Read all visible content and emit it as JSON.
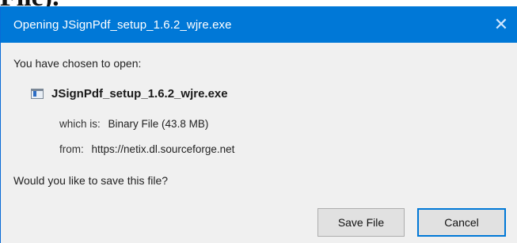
{
  "background_fragment": "File).",
  "dialog": {
    "title": "Opening JSignPdf_setup_1.6.2_wjre.exe",
    "close_glyph": "✕",
    "prompt": "You have chosen to open:",
    "file": {
      "icon": "executable-file-icon",
      "name": "JSignPdf_setup_1.6.2_wjre.exe"
    },
    "which_is": {
      "key": "which is:",
      "value": "Binary File (43.8 MB)"
    },
    "from": {
      "key": "from:",
      "value": "https://netix.dl.sourceforge.net"
    },
    "question": "Would you like to save this file?",
    "buttons": {
      "save": "Save File",
      "cancel": "Cancel"
    }
  },
  "colors": {
    "titlebar": "#0078d7",
    "dialog_bg": "#f0f0f0",
    "button_bg": "#e1e1e1",
    "focus_border": "#0078d7"
  }
}
